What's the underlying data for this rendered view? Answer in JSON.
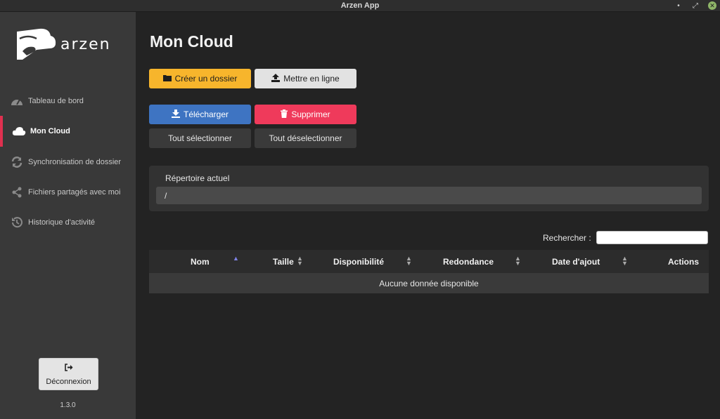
{
  "window": {
    "title": "Arzen App",
    "min_glyph": "•",
    "max_glyph": "⤢",
    "close_glyph": "✕"
  },
  "sidebar": {
    "logo_text": "arzen",
    "items": [
      {
        "label": "Tableau de bord",
        "icon": "dashboard-gauge-icon"
      },
      {
        "label": "Mon Cloud",
        "icon": "cloud-icon",
        "active": true
      },
      {
        "label": "Synchronisation de dossier",
        "icon": "sync-icon"
      },
      {
        "label": "Fichiers partagés avec moi",
        "icon": "share-icon"
      },
      {
        "label": "Historique d'activité",
        "icon": "history-icon"
      }
    ],
    "logout_label": "Déconnexion",
    "version": "1.3.0"
  },
  "main": {
    "title": "Mon Cloud",
    "buttons": {
      "create_folder": "Créer un dossier",
      "upload": "Mettre en ligne",
      "download": "Télécharger",
      "delete": "Supprimer",
      "select_all": "Tout sélectionner",
      "deselect_all": "Tout déselectionner"
    },
    "directory": {
      "label": "Répertoire actuel",
      "value": "/"
    },
    "search": {
      "label": "Rechercher :",
      "value": ""
    },
    "table": {
      "columns": [
        "Nom",
        "Taille",
        "Disponibilité",
        "Redondance",
        "Date d'ajout",
        "Actions"
      ],
      "empty_text": "Aucune donnée disponible"
    }
  },
  "colors": {
    "accent_red": "#e0304f",
    "yellow": "#f7b52c",
    "blue": "#3e74c2",
    "red": "#ef3a5b"
  }
}
